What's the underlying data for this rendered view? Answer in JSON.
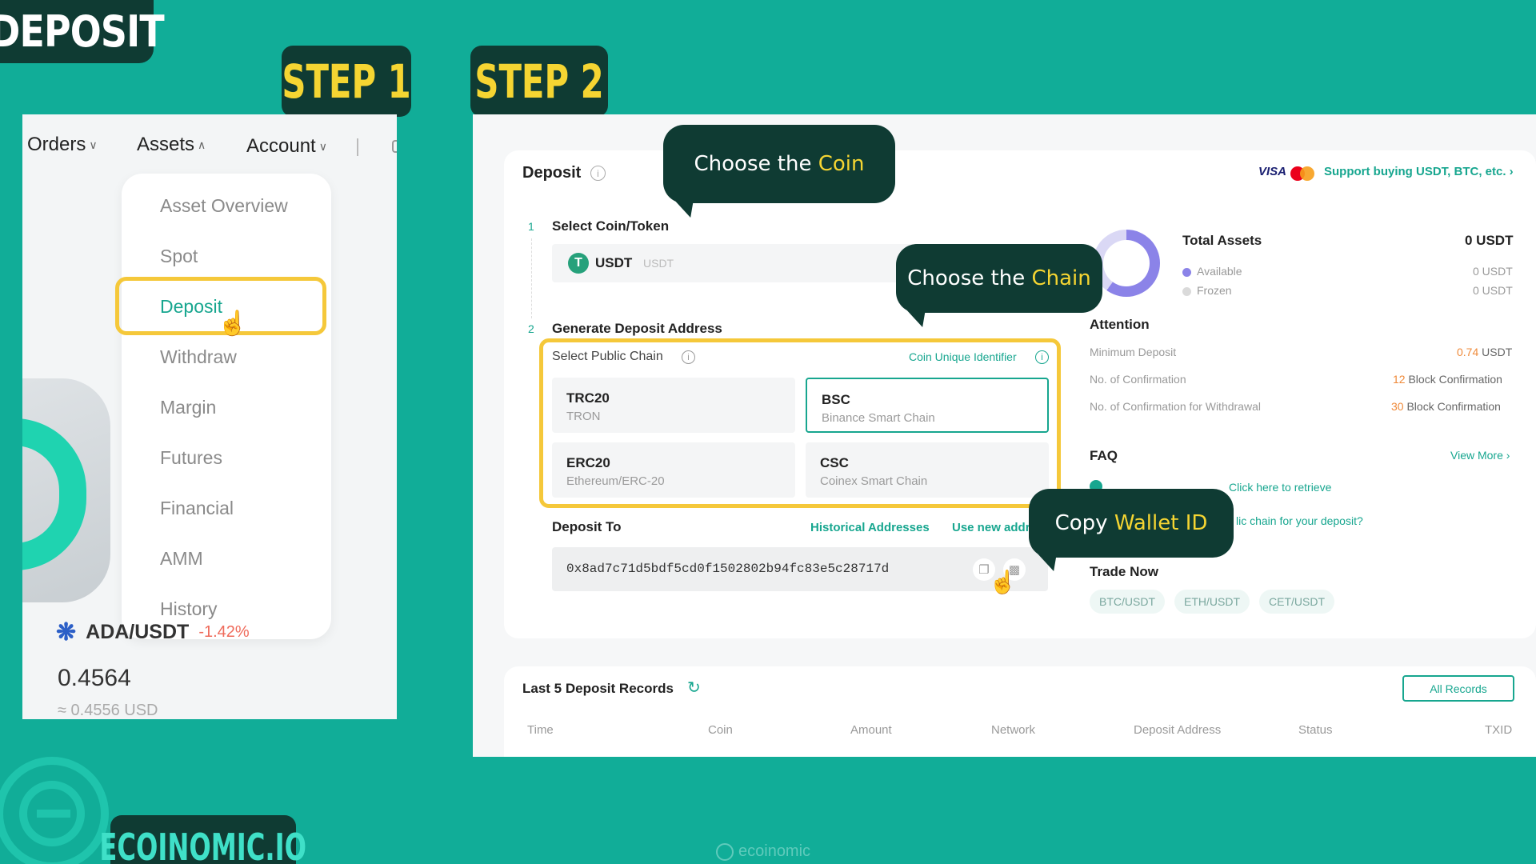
{
  "header": {
    "title": "DEPOSIT",
    "step1": "STEP 1",
    "step2": "STEP 2"
  },
  "step1": {
    "nav": {
      "orders": "Orders",
      "assets": "Assets",
      "account": "Account"
    },
    "menu": [
      "Asset Overview",
      "Spot",
      "Deposit",
      "Withdraw",
      "Margin",
      "Futures",
      "Financial",
      "AMM",
      "History"
    ],
    "ticker": {
      "pair": "ADA/USDT",
      "change": "-1.42%",
      "price": "0.4564",
      "usd": "≈ 0.4556 USD"
    }
  },
  "step2": {
    "title": "Deposit",
    "visa": "VISA",
    "support_link": "Support buying USDT, BTC, etc. ›",
    "select_coin": {
      "index": "1",
      "label": "Select Coin/Token",
      "coin": "USDT",
      "coin_sub": "USDT"
    },
    "generate": {
      "index": "2",
      "label": "Generate Deposit Address"
    },
    "public_chain": {
      "label": "Select Public Chain",
      "unique_id": "Coin Unique Identifier"
    },
    "chains": [
      {
        "name": "TRC20",
        "sub": "TRON"
      },
      {
        "name": "BSC",
        "sub": "Binance Smart Chain"
      },
      {
        "name": "ERC20",
        "sub": "Ethereum/ERC-20"
      },
      {
        "name": "CSC",
        "sub": "Coinex Smart Chain"
      }
    ],
    "deposit_to": {
      "label": "Deposit To",
      "historical": "Historical Addresses",
      "use_new": "Use new addr",
      "address": "0x8ad7c71d5bdf5cd0f1502802b94fc83e5c28717d"
    },
    "total_assets": {
      "label": "Total Assets",
      "value": "0 USDT",
      "available_label": "Available",
      "available": "0 USDT",
      "frozen_label": "Frozen",
      "frozen": "0 USDT"
    },
    "attention": {
      "label": "Attention",
      "rows": [
        {
          "label": "Minimum Deposit",
          "num": "0.74",
          "unit": " USDT"
        },
        {
          "label": "No. of Confirmation",
          "num": "12",
          "unit": " Block Confirmation"
        },
        {
          "label": "No. of Confirmation for Withdrawal",
          "num": "30",
          "unit": " Block Confirmation"
        }
      ]
    },
    "faq": {
      "label": "FAQ",
      "view_more": "View More ›",
      "q1_link": "Click here to retrieve",
      "q2": "lic chain for your deposit?"
    },
    "trade_now": {
      "label": "Trade Now",
      "pairs": [
        "BTC/USDT",
        "ETH/USDT",
        "CET/USDT"
      ]
    },
    "records": {
      "title": "Last 5 Deposit Records",
      "all_records": "All Records",
      "columns": [
        "Time",
        "Coin",
        "Amount",
        "Network",
        "Deposit Address",
        "Status",
        "TXID"
      ]
    }
  },
  "bubbles": {
    "coin_pre": "Choose the ",
    "coin_hl": "Coin",
    "chain_pre": "Choose the ",
    "chain_hl": "Chain",
    "wallet_pre": "Copy ",
    "wallet_hl": "Wallet ID"
  },
  "footer": {
    "brand": "ECOINOMIC.IO",
    "watermark": "ecoinomic"
  },
  "colors": {
    "background": "#11ad98",
    "dark": "#0f3b33",
    "highlight": "#f5c83a",
    "accent_yellow": "#f5d532",
    "teal_text": "#17a68f"
  }
}
